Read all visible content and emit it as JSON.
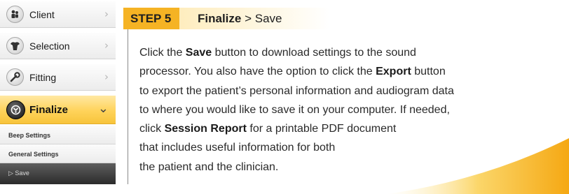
{
  "nav": {
    "items": [
      {
        "label": "Client",
        "icon": "client-icon",
        "chevron": "›"
      },
      {
        "label": "Selection",
        "icon": "selection-icon",
        "chevron": "›"
      },
      {
        "label": "Fitting",
        "icon": "fitting-wrench-icon",
        "chevron": "›"
      },
      {
        "label": "Finalize",
        "icon": "finalize-icon",
        "chevron": "⌄",
        "active": true
      }
    ],
    "subitems": [
      "Beep Settings",
      "General Settings",
      "▷ Save"
    ]
  },
  "step": {
    "badge": "STEP 5",
    "section": "Finalize",
    "separator": " > ",
    "action": "Save"
  },
  "instructions": {
    "l1_a": "Click the ",
    "l1_b": "Save",
    "l1_c": " button to download settings to the sound",
    "l2_a": "processor. You also have the option to click the ",
    "l2_b": "Export",
    "l2_c": " button",
    "l3": "to export the patient’s personal information and audiogram data",
    "l4": "to where you would like to save it on your computer. If needed,",
    "l5_a": "click ",
    "l5_b": "Session Report",
    "l5_c": " for a printable PDF document",
    "l6": "that includes useful information for both",
    "l7": "the patient and the clinician."
  },
  "colors": {
    "accent": "#f5b324",
    "active_nav": "#ffd35a",
    "text": "#2a2a2a"
  }
}
